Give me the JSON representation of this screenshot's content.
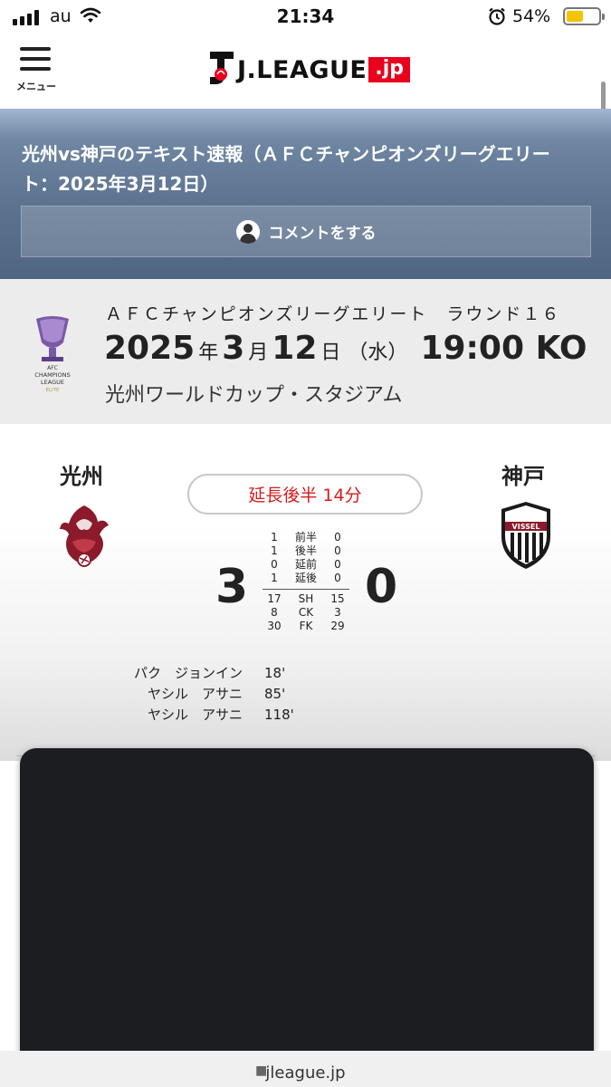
{
  "status_bar": {
    "carrier": "au",
    "time": "21:34",
    "battery_percent": "54%",
    "battery_level": 0.54,
    "battery_color": "#f5c400"
  },
  "header": {
    "menu_label": "メニュー",
    "logo_text": "J.LEAGUE",
    "logo_suffix": ".jp",
    "brand_color": "#e8001c"
  },
  "hero": {
    "title": "光州vs神戸のテキスト速報（ＡＦＣチャンピオンズリーグエリート：2025年3月12日）",
    "comment_button": "コメントをする"
  },
  "match": {
    "competition": "ＡＦＣチャンピオンズリーグエリート　ラウンド１６",
    "year": "2025",
    "year_unit": "年",
    "month": "3",
    "month_unit": "月",
    "day": "12",
    "day_unit": "日",
    "weekday": "（水）",
    "kickoff": "19:00 KO",
    "stadium": "光州ワールドカップ・スタジアム",
    "acl_logo_text": [
      "AFC",
      "CHAMPIONS",
      "LEAGUE",
      "ELITE"
    ]
  },
  "score": {
    "home_team": "光州",
    "away_team": "神戸",
    "status": "延長後半 14分",
    "status_color": "#d61a1a",
    "home_goals": "3",
    "away_goals": "0",
    "home_color": "#8b1a2b",
    "away_badge_text": "VISSEL",
    "periods": [
      {
        "home": "1",
        "label": "前半",
        "away": "0"
      },
      {
        "home": "1",
        "label": "後半",
        "away": "0"
      },
      {
        "home": "0",
        "label": "延前",
        "away": "0"
      },
      {
        "home": "1",
        "label": "延後",
        "away": "0"
      }
    ],
    "stats": [
      {
        "home": "17",
        "label": "SH",
        "away": "15"
      },
      {
        "home": "8",
        "label": "CK",
        "away": "3"
      },
      {
        "home": "30",
        "label": "FK",
        "away": "29"
      }
    ],
    "scorers": [
      {
        "name": "パク　ジョンイン",
        "minute": "18'"
      },
      {
        "name": "ヤシル　アサニ",
        "minute": "85'"
      },
      {
        "name": "ヤシル　アサニ",
        "minute": "118'"
      }
    ]
  },
  "url_bar": {
    "domain": "jleague.jp"
  }
}
